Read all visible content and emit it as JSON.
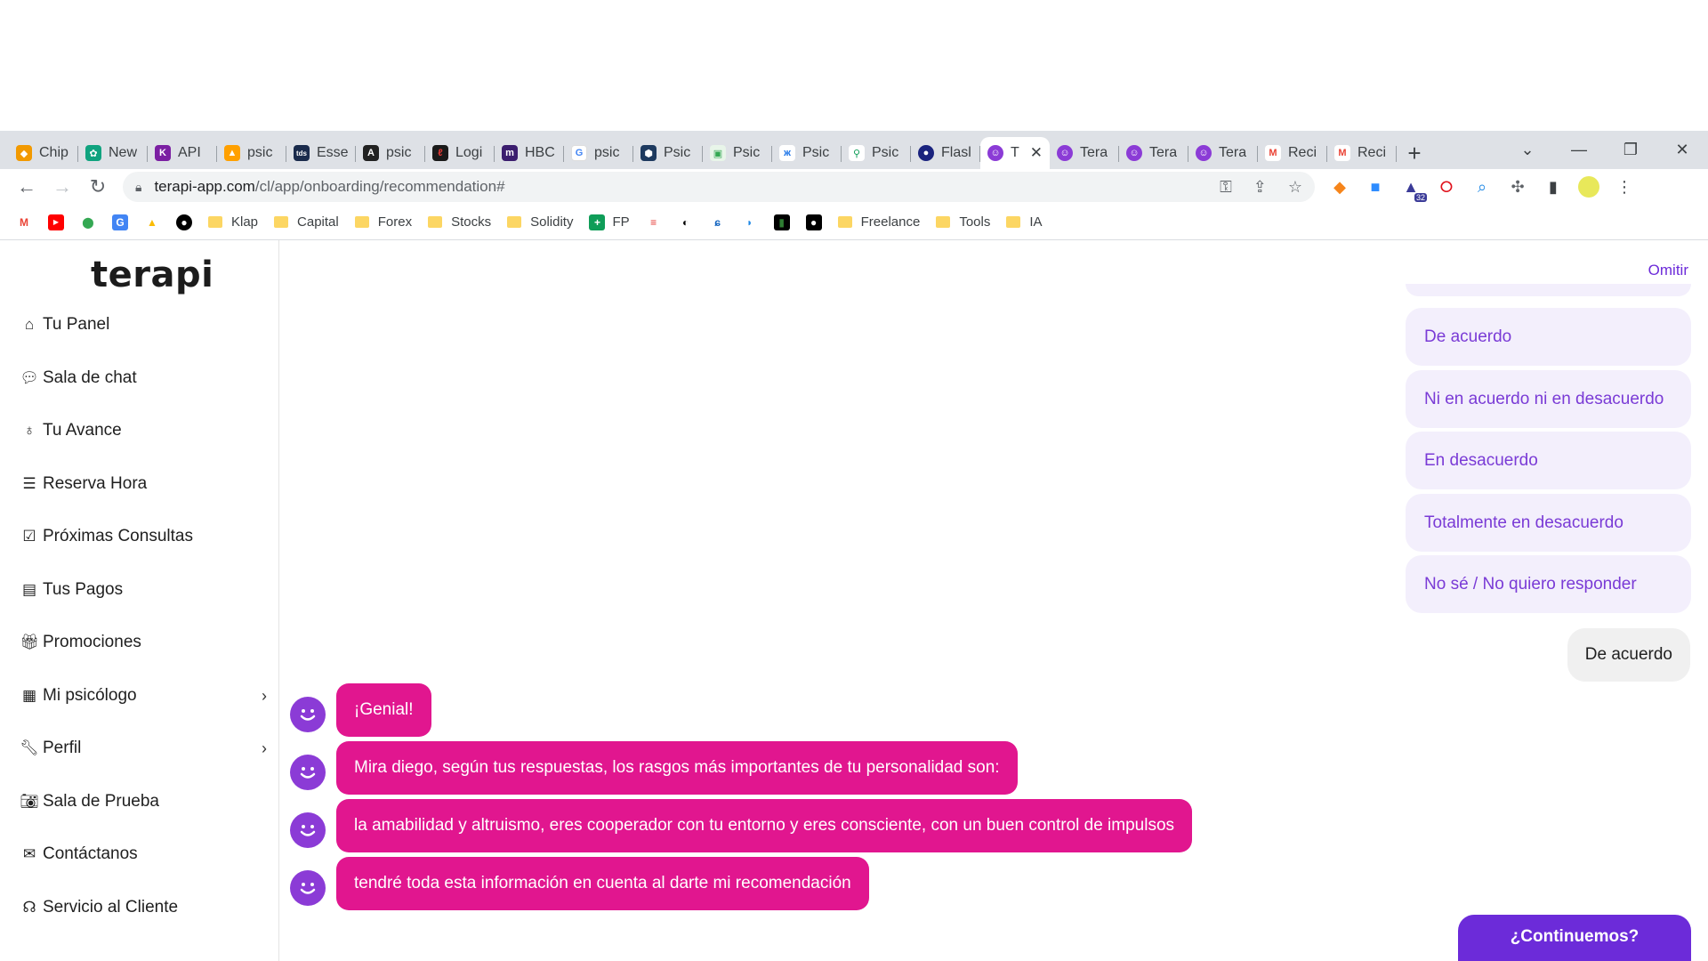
{
  "browser": {
    "tabs": [
      {
        "title": "Chip",
        "icon": "shield-icon",
        "color": "#f29900"
      },
      {
        "title": "New",
        "icon": "openai-icon",
        "color": "#10a37f"
      },
      {
        "title": "API",
        "icon": "k-icon",
        "color": "#7b1fa2"
      },
      {
        "title": "psic",
        "icon": "firebase-icon",
        "color": "#ffa000"
      },
      {
        "title": "Esse",
        "icon": "tds-icon",
        "color": "#1a2b4c"
      },
      {
        "title": "psic",
        "icon": "angular-icon",
        "color": "#222222"
      },
      {
        "title": "Logi",
        "icon": "logo-icon",
        "color": "#1a1a1a"
      },
      {
        "title": "HBC",
        "icon": "m-icon",
        "color": "#3b1d6e"
      },
      {
        "title": "psic",
        "icon": "google-icon",
        "color": "#4285f4"
      },
      {
        "title": "Psic",
        "icon": "hexagon-icon",
        "color": "#1e3a5f"
      },
      {
        "title": "Psic",
        "icon": "image-icon",
        "color": "#34a853"
      },
      {
        "title": "Psic",
        "icon": "butterfly-icon",
        "color": "#1a73e8"
      },
      {
        "title": "Psic",
        "icon": "pin-icon",
        "color": "#0f9d58"
      },
      {
        "title": "Flasl",
        "icon": "globe-icon",
        "color": "#1a237e"
      },
      {
        "title": "T",
        "icon": "terapi-icon",
        "color": "#8b3bd6",
        "active": true
      },
      {
        "title": "Tera",
        "icon": "terapi-icon",
        "color": "#8b3bd6"
      },
      {
        "title": "Tera",
        "icon": "terapi-icon",
        "color": "#8b3bd6"
      },
      {
        "title": "Tera",
        "icon": "terapi-icon",
        "color": "#8b3bd6"
      },
      {
        "title": "Reci",
        "icon": "gmail-icon",
        "color": "#ea4335"
      },
      {
        "title": "Reci",
        "icon": "gmail-icon",
        "color": "#ea4335"
      }
    ],
    "url_host": "terapi-app.com",
    "url_path": "/cl/app/onboarding/recommendation#",
    "bookmarks": [
      {
        "label": "Klap"
      },
      {
        "label": "Capital"
      },
      {
        "label": "Forex"
      },
      {
        "label": "Stocks"
      },
      {
        "label": "Solidity"
      },
      {
        "label": "FP"
      },
      {
        "label": "Freelance"
      },
      {
        "label": "Tools"
      },
      {
        "label": "IA"
      }
    ],
    "extension_badge": "32"
  },
  "sidebar": {
    "logo": "terapi",
    "items": [
      {
        "label": "Tu Panel",
        "icon": "home-icon"
      },
      {
        "label": "Sala de chat",
        "icon": "chat-icon"
      },
      {
        "label": "Tu Avance",
        "icon": "award-icon"
      },
      {
        "label": "Reserva Hora",
        "icon": "list-icon"
      },
      {
        "label": "Próximas Consultas",
        "icon": "calendar-check-icon"
      },
      {
        "label": "Tus Pagos",
        "icon": "money-icon"
      },
      {
        "label": "Promociones",
        "icon": "gift-icon"
      },
      {
        "label": "Mi psicólogo",
        "icon": "id-card-icon"
      },
      {
        "label": "Perfil",
        "icon": "wrench-icon"
      },
      {
        "label": "Sala de Prueba",
        "icon": "camera-icon"
      },
      {
        "label": "Contáctanos",
        "icon": "envelope-icon"
      },
      {
        "label": "Servicio al Cliente",
        "icon": "headset-icon"
      }
    ]
  },
  "main": {
    "skip_label": "Omitir",
    "options": [
      "De acuerdo",
      "Ni en acuerdo ni en desacuerdo",
      "En desacuerdo",
      "Totalmente en desacuerdo",
      "No sé / No quiero responder"
    ],
    "user_reply": "De acuerdo",
    "bot_messages": [
      "¡Genial!",
      "Mira diego, según tus respuestas, los rasgos más importantes de tu personalidad son:",
      "la amabilidad y altruismo, eres cooperador con tu entorno y eres consciente, con un buen control de impulsos",
      "tendré toda esta información en cuenta al darte mi recomendación"
    ],
    "continue_label": "¿Continuemos?"
  },
  "colors": {
    "brand_purple": "#6c2bd9",
    "option_bg": "#f3effc",
    "bot_bubble": "#e1168f",
    "avatar": "#8b3bd6"
  }
}
